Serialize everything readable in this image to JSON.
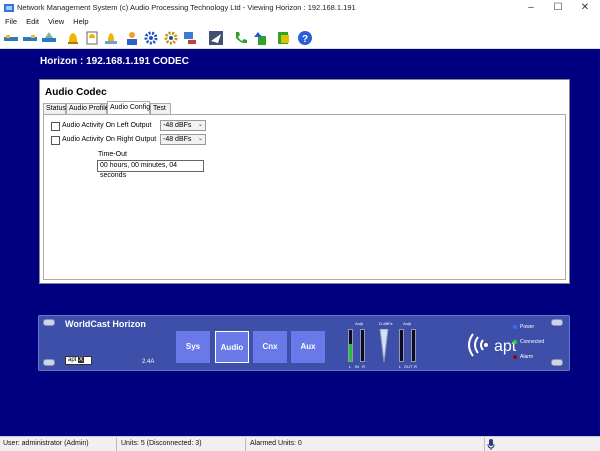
{
  "window": {
    "title": "Network Management System (c) Audio Processing Technology Ltd - Viewing Horizon : 192.168.1.191",
    "min": "–",
    "max": "☐",
    "close": "✕"
  },
  "menu": [
    "File",
    "Edit",
    "View",
    "Help"
  ],
  "toolbar_icons": [
    "connect-icon",
    "disconnect-icon",
    "find-units-icon",
    "alarm-bell-icon",
    "alarm-log-icon",
    "clear-alarm-icon",
    "user-icon",
    "settings-gear-icon",
    "config-gear-icon",
    "network-icon",
    "send-icon",
    "phone-icon",
    "upload-icon",
    "download-icon",
    "help-icon"
  ],
  "header": {
    "unit": "Horizon : 192.168.1.191 CODEC"
  },
  "panel": {
    "title": "Audio Codec",
    "tabs": [
      "Status",
      "Audio Profile",
      "Audio Config",
      "Test"
    ],
    "active_tab": "Audio Config",
    "left_output": {
      "label": "Audio Activity On Left Output",
      "checked": false,
      "level": "-48 dBFs"
    },
    "right_output": {
      "label": "Audio Activity On Right Output",
      "checked": false,
      "level": "-48 dBFs"
    },
    "timeout": {
      "label": "Time-Out",
      "value": "00 hours, 00 minutes, 04 seconds"
    }
  },
  "device": {
    "name": "WorldCast Horizon",
    "buttons": [
      "Sys",
      "Audio",
      "Cnx",
      "Aux"
    ],
    "selected_button": "Audio",
    "version": "2.4A",
    "badge": "apt",
    "badge_mark": "X",
    "logo": "apt",
    "meters": {
      "left_title": "AoIp",
      "mid_title": "D-dBFs",
      "right_title": "AoIp",
      "in_labels": [
        "L",
        "IN",
        "R"
      ],
      "out_labels": [
        "L",
        "OUT",
        "R"
      ],
      "in_level": 0.55
    },
    "status_leds": [
      {
        "label": "Power",
        "color": "#2f6fff"
      },
      {
        "label": "Connected",
        "color": "#22dd22"
      },
      {
        "label": "Alarm",
        "color": "#8a0a0a"
      }
    ]
  },
  "status": {
    "user": "User: administrator (Admin)",
    "units": "Units: 5 (Disconnected: 3)",
    "alarmed": "Alarmed Units: 0"
  }
}
